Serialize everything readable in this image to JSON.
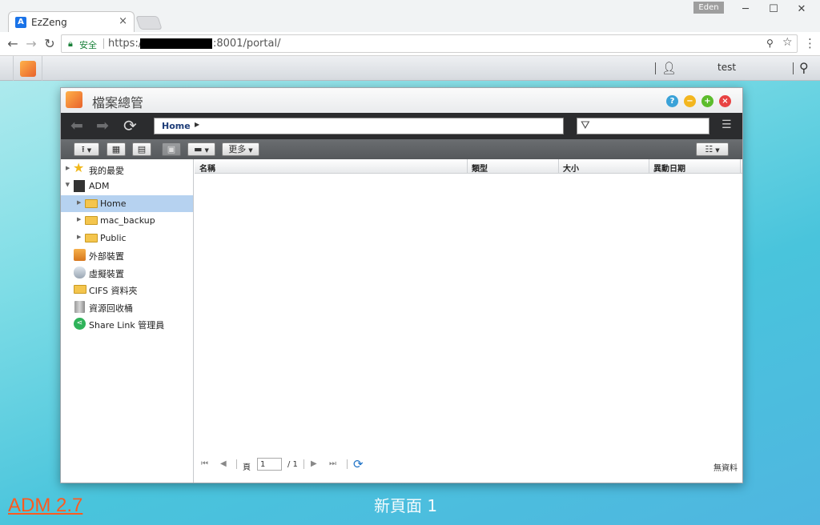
{
  "browser": {
    "tab_title": "EzZeng",
    "tab_close": "×",
    "favicon_letter": "A",
    "profile_name": "Eden",
    "url_secure_label": "安全",
    "url_prefix": "https://",
    "url_suffix": ":8001/portal/",
    "icons": [
      "back-arrow-icon",
      "forward-arrow-icon",
      "reload-icon",
      "lock-icon",
      "extension-icon",
      "bookmark-star-icon",
      "menu-dots-icon"
    ]
  },
  "adm_bar": {
    "user_name": "test"
  },
  "file_manager": {
    "title": "檔案總管",
    "path_home": "Home",
    "toolbar": {
      "more_label": "更多"
    },
    "sidebar": {
      "items": [
        {
          "label": "我的最愛"
        },
        {
          "label": "ADM"
        },
        {
          "label": "Home"
        },
        {
          "label": "mac_backup"
        },
        {
          "label": "Public"
        },
        {
          "label": "外部裝置"
        },
        {
          "label": "虛擬裝置"
        },
        {
          "label": "CIFS 資料夾"
        },
        {
          "label": "資源回收桶"
        },
        {
          "label": "Share Link 管理員"
        }
      ]
    },
    "columns": [
      "名稱",
      "類型",
      "大小",
      "異動日期"
    ],
    "pager": {
      "page_label": "頁",
      "page_value": "1",
      "page_total": "/ 1",
      "empty_text": "無資料"
    }
  },
  "desktop": {
    "version_text": "ADM 2.7",
    "caption": "新頁面 1"
  },
  "colors": {
    "accent_orange": "#ff5a1f",
    "selection_blue": "#b6d2f0",
    "nav_dark": "#2b2c2e",
    "ctrl_help": "#3aa2d8",
    "ctrl_min": "#f3b61f",
    "ctrl_max": "#5cbc2c",
    "ctrl_close": "#e84343"
  }
}
